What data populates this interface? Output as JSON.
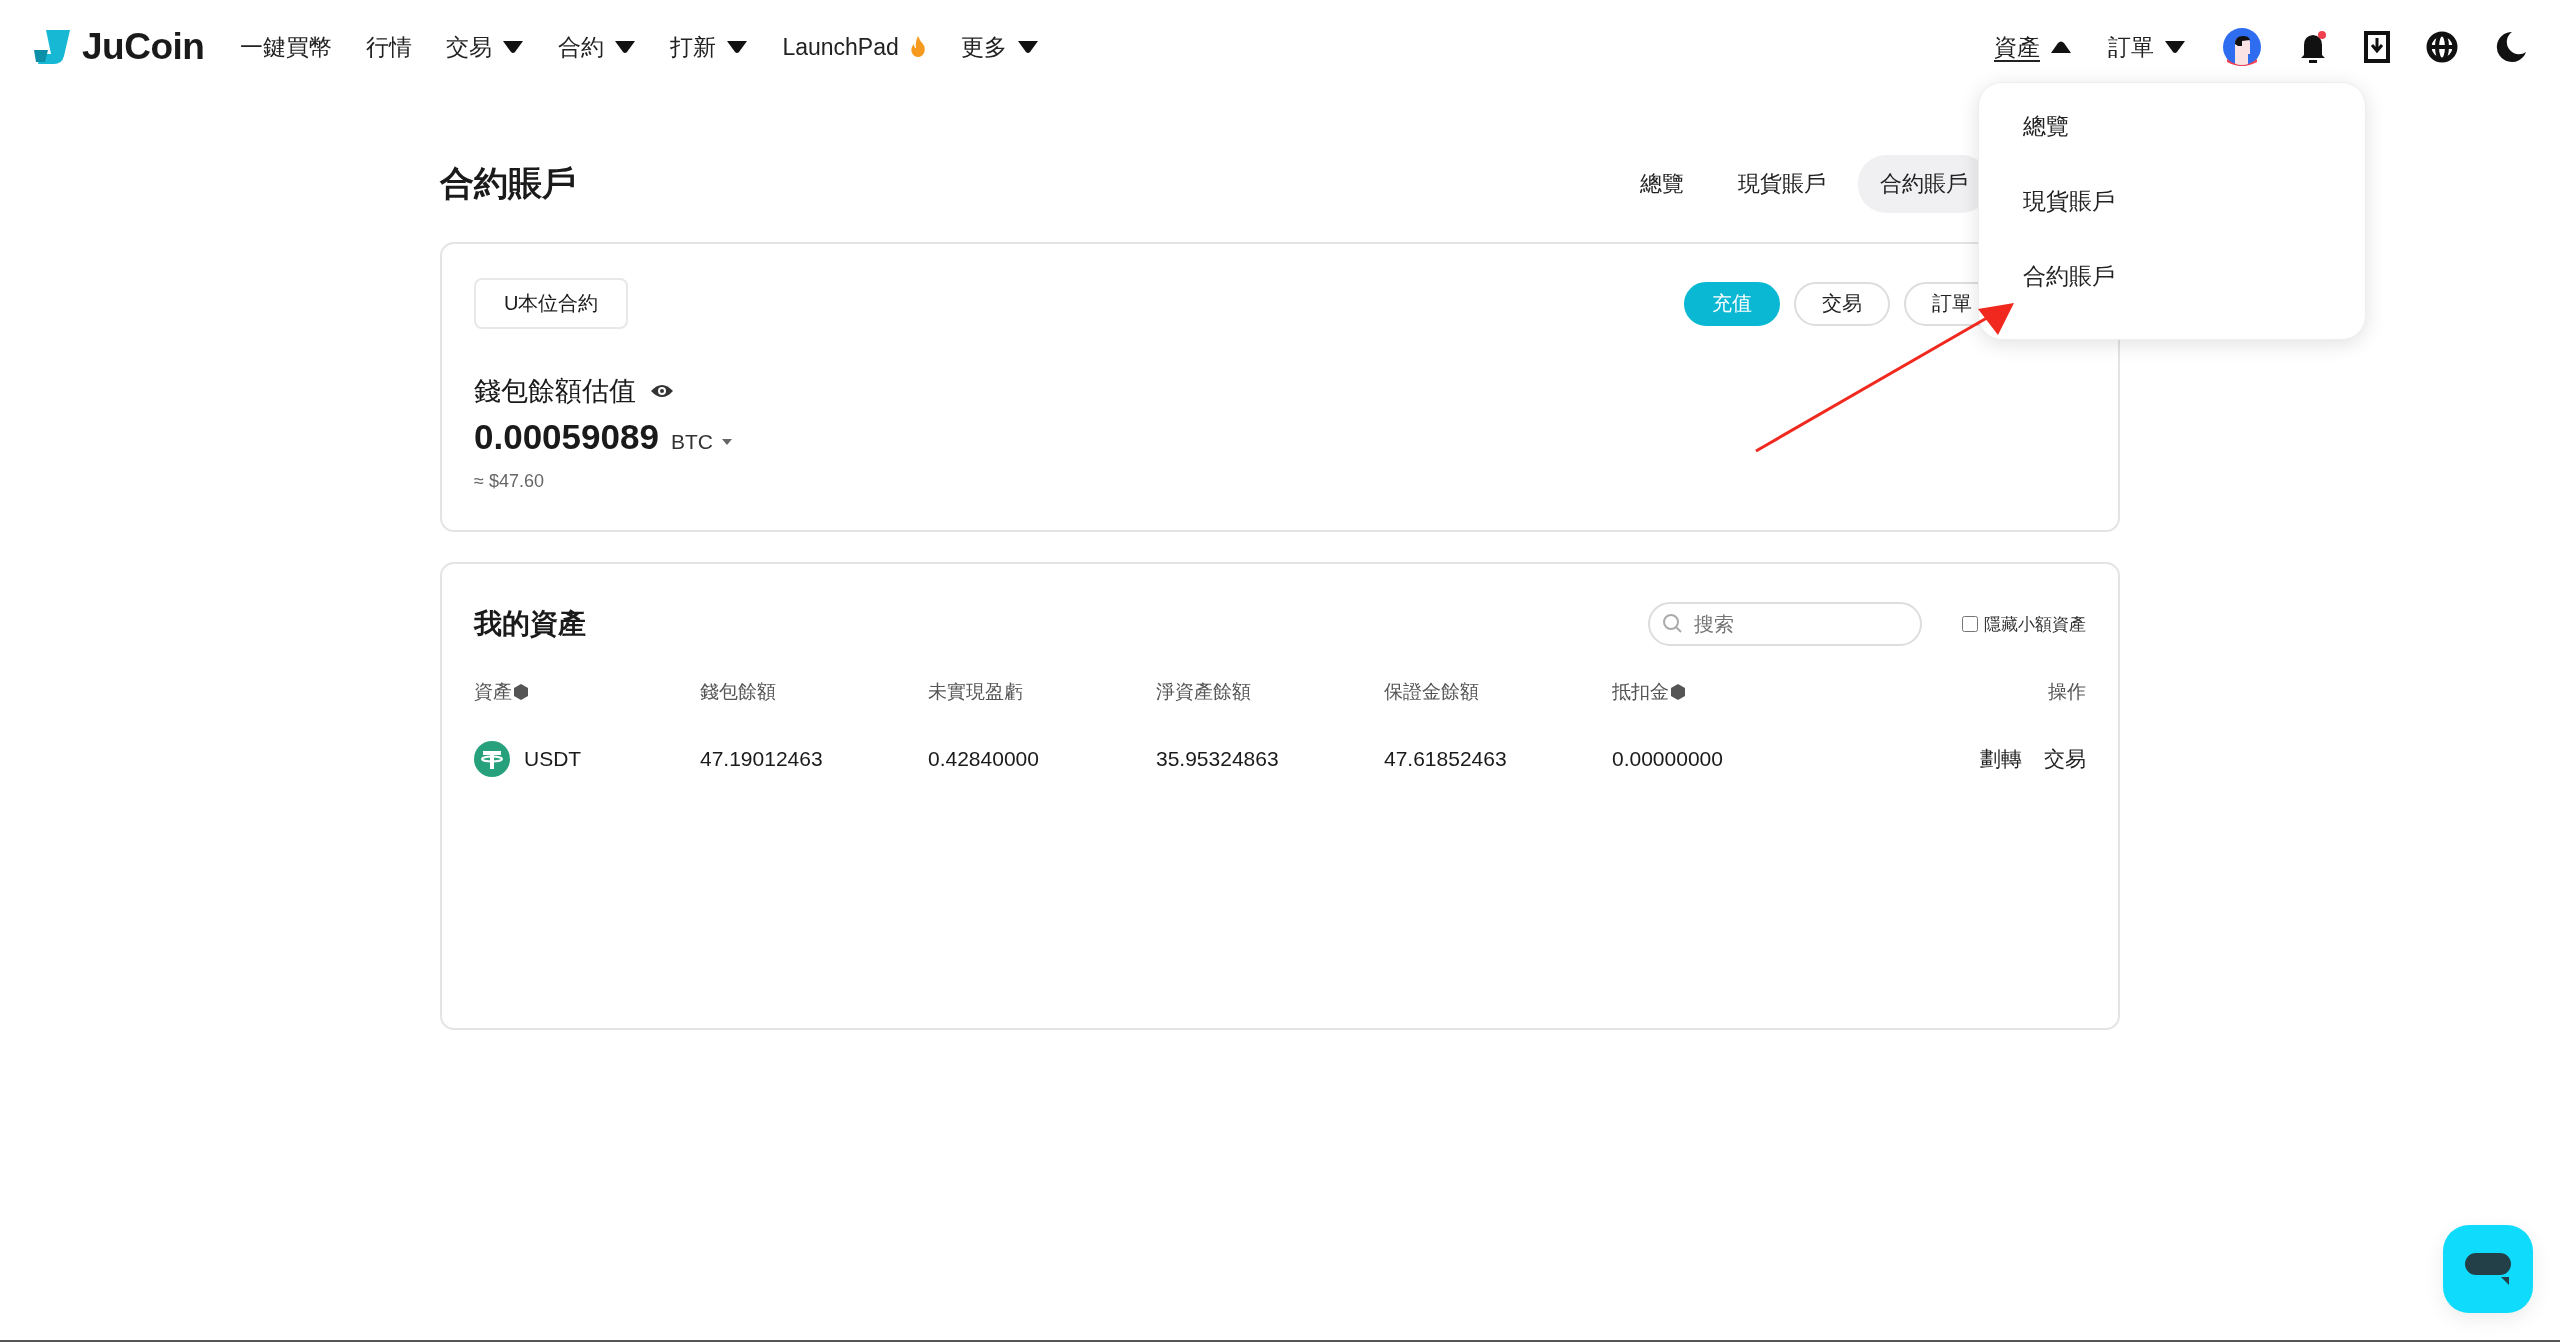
{
  "header": {
    "logo": "JuCoin",
    "nav": [
      {
        "label": "一鍵買幣",
        "dropdown": false
      },
      {
        "label": "行情",
        "dropdown": false
      },
      {
        "label": "交易",
        "dropdown": true
      },
      {
        "label": "合約",
        "dropdown": true
      },
      {
        "label": "打新",
        "dropdown": true
      },
      {
        "label": "LaunchPad",
        "dropdown": false,
        "hot": true
      },
      {
        "label": "更多",
        "dropdown": true
      }
    ],
    "right_menus": [
      {
        "label": "資產",
        "expanded": true
      },
      {
        "label": "訂單",
        "expanded": false
      }
    ],
    "notification_dot": true
  },
  "assets_menu": {
    "items": [
      "總覽",
      "現貨賬戶",
      "合約賬戶"
    ]
  },
  "page": {
    "title": "合約賬戶",
    "tabs": [
      {
        "label": "總覽",
        "selected": false
      },
      {
        "label": "現貨賬戶",
        "selected": false
      },
      {
        "label": "合約賬戶",
        "selected": true
      }
    ]
  },
  "summary": {
    "account_type": "U本位合約",
    "buttons": [
      {
        "label": "充值",
        "primary": true
      },
      {
        "label": "交易",
        "primary": false
      },
      {
        "label": "訂單",
        "primary": false
      }
    ],
    "balance_label": "錢包餘額估值",
    "balance": "0.00059089",
    "currency": "BTC",
    "approx": "≈ $47.60"
  },
  "assets": {
    "title": "我的資產",
    "search": {
      "placeholder": "搜索"
    },
    "hide_small": {
      "label": "隱藏小額資產",
      "checked": false
    },
    "columns": [
      {
        "label": "資產",
        "sortable": true
      },
      {
        "label": "錢包餘額",
        "sortable": false
      },
      {
        "label": "未實現盈虧",
        "sortable": false
      },
      {
        "label": "淨資產餘額",
        "sortable": false
      },
      {
        "label": "保證金餘額",
        "sortable": false
      },
      {
        "label": "抵扣金",
        "sortable": true
      },
      {
        "label": "操作",
        "sortable": false
      }
    ],
    "rows": [
      {
        "cells": [
          "USDT",
          "47.19012463",
          "0.42840000",
          "35.95324863",
          "47.61852463",
          "0.00000000"
        ],
        "actions": [
          "劃轉",
          "交易"
        ]
      }
    ]
  }
}
